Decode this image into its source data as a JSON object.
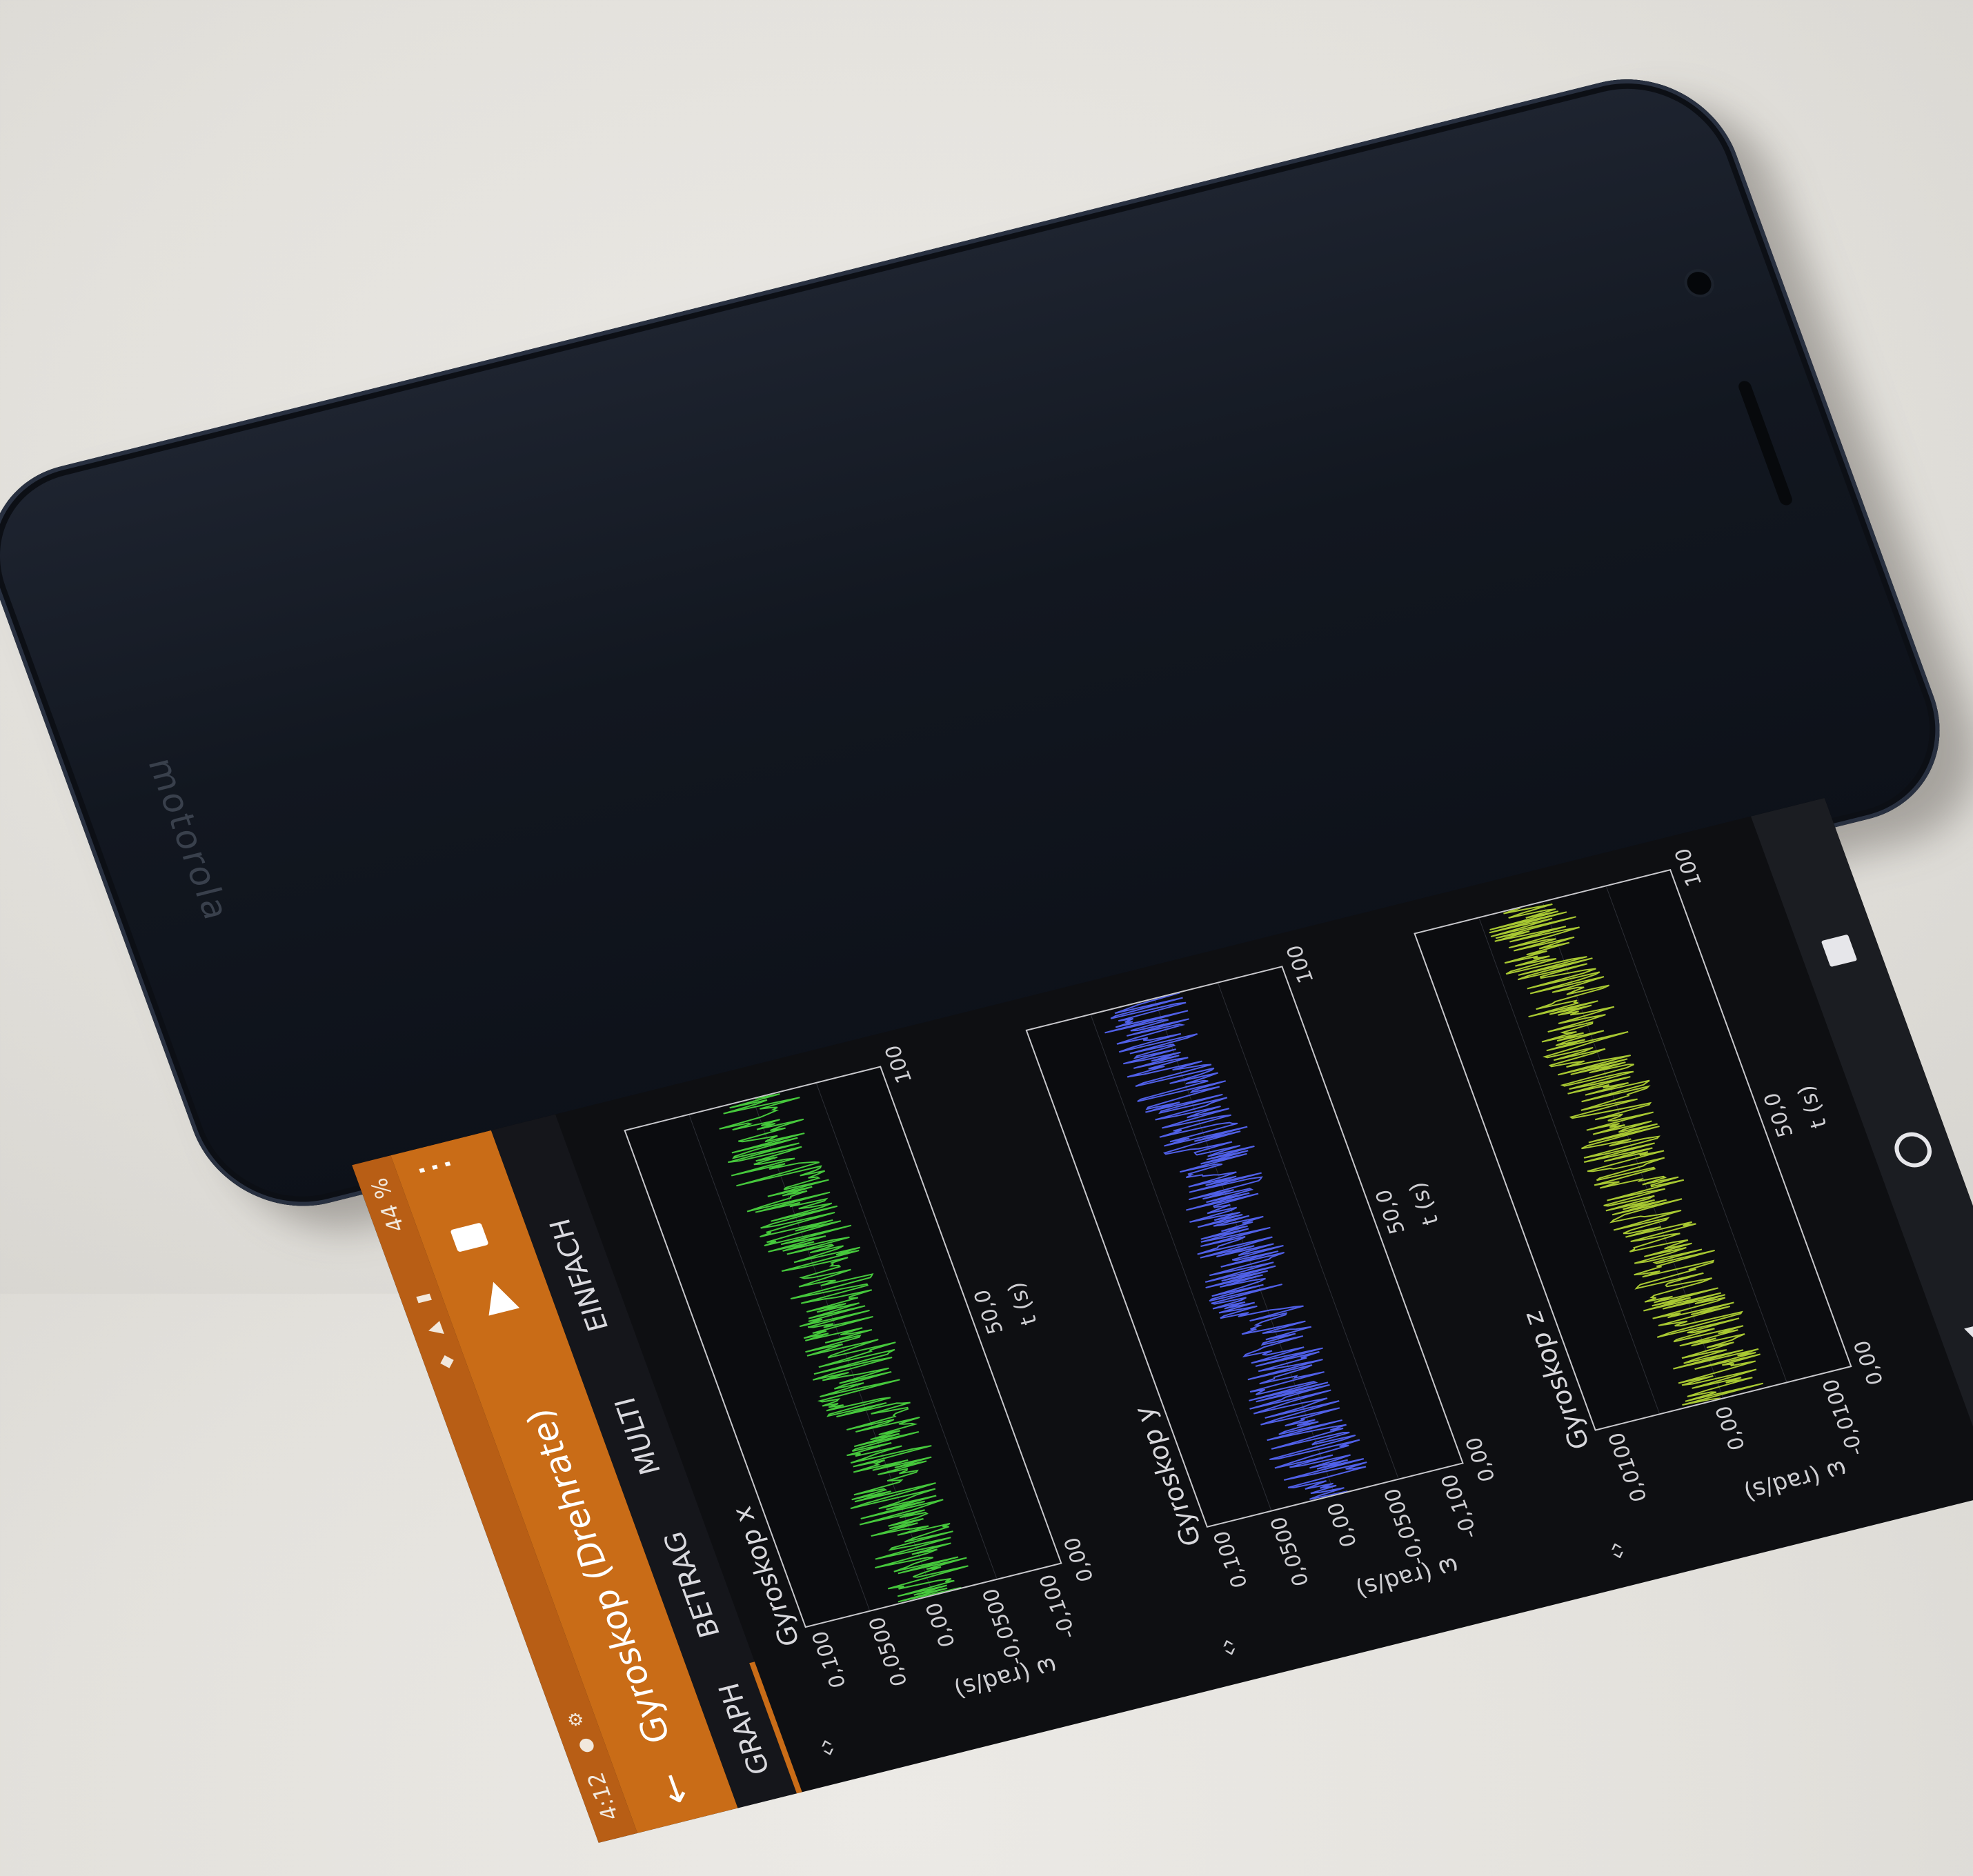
{
  "device": {
    "brand": "motorola"
  },
  "status_bar": {
    "time": "4:12",
    "battery": "44 %",
    "icons": [
      "notification-icon",
      "settings-icon",
      "wifi-icon",
      "signal-icon",
      "battery-icon"
    ]
  },
  "app_bar": {
    "title": "Gyroskop (Drehrate)",
    "icons": [
      "back-arrow-icon",
      "play-icon",
      "delete-icon",
      "more-vert-icon"
    ]
  },
  "tabs": [
    {
      "label": "GRAPH",
      "selected": true
    },
    {
      "label": "BETRAG",
      "selected": false
    },
    {
      "label": "MULTI",
      "selected": false
    },
    {
      "label": "EINFACH",
      "selected": false
    }
  ],
  "graphs": [
    {
      "title": "Gyroskop x",
      "ylabel": "ω (rad/s)",
      "yticks": [
        "0,100",
        "0,0500",
        "0,00",
        "-0,0500",
        "-0,100"
      ],
      "xticks": [
        "0,00",
        "50,0",
        "100"
      ],
      "xlabel": "t (s)",
      "color": "#46c83c",
      "expand_icon": "expand-icon"
    },
    {
      "title": "Gyroskop y",
      "ylabel": "ω (rad/s)",
      "yticks": [
        "0,100",
        "0,0500",
        "0,00",
        "-0,0500",
        "-0,100"
      ],
      "xticks": [
        "0,00",
        "50,0",
        "100"
      ],
      "xlabel": "t (s)",
      "color": "#5060e8",
      "expand_icon": "expand-icon"
    },
    {
      "title": "Gyroskop z",
      "ylabel": "ω (rad/s)",
      "yticks": [
        "0,0100",
        "0,00",
        "-0,0100"
      ],
      "xticks": [
        "0,00",
        "50,0",
        "100"
      ],
      "xlabel": "t (s)",
      "color": "#a8c832",
      "expand_icon": "expand-icon"
    }
  ],
  "nav_bar": {
    "icons": [
      "nav-back-icon",
      "nav-home-icon",
      "nav-recent-icon"
    ]
  }
}
